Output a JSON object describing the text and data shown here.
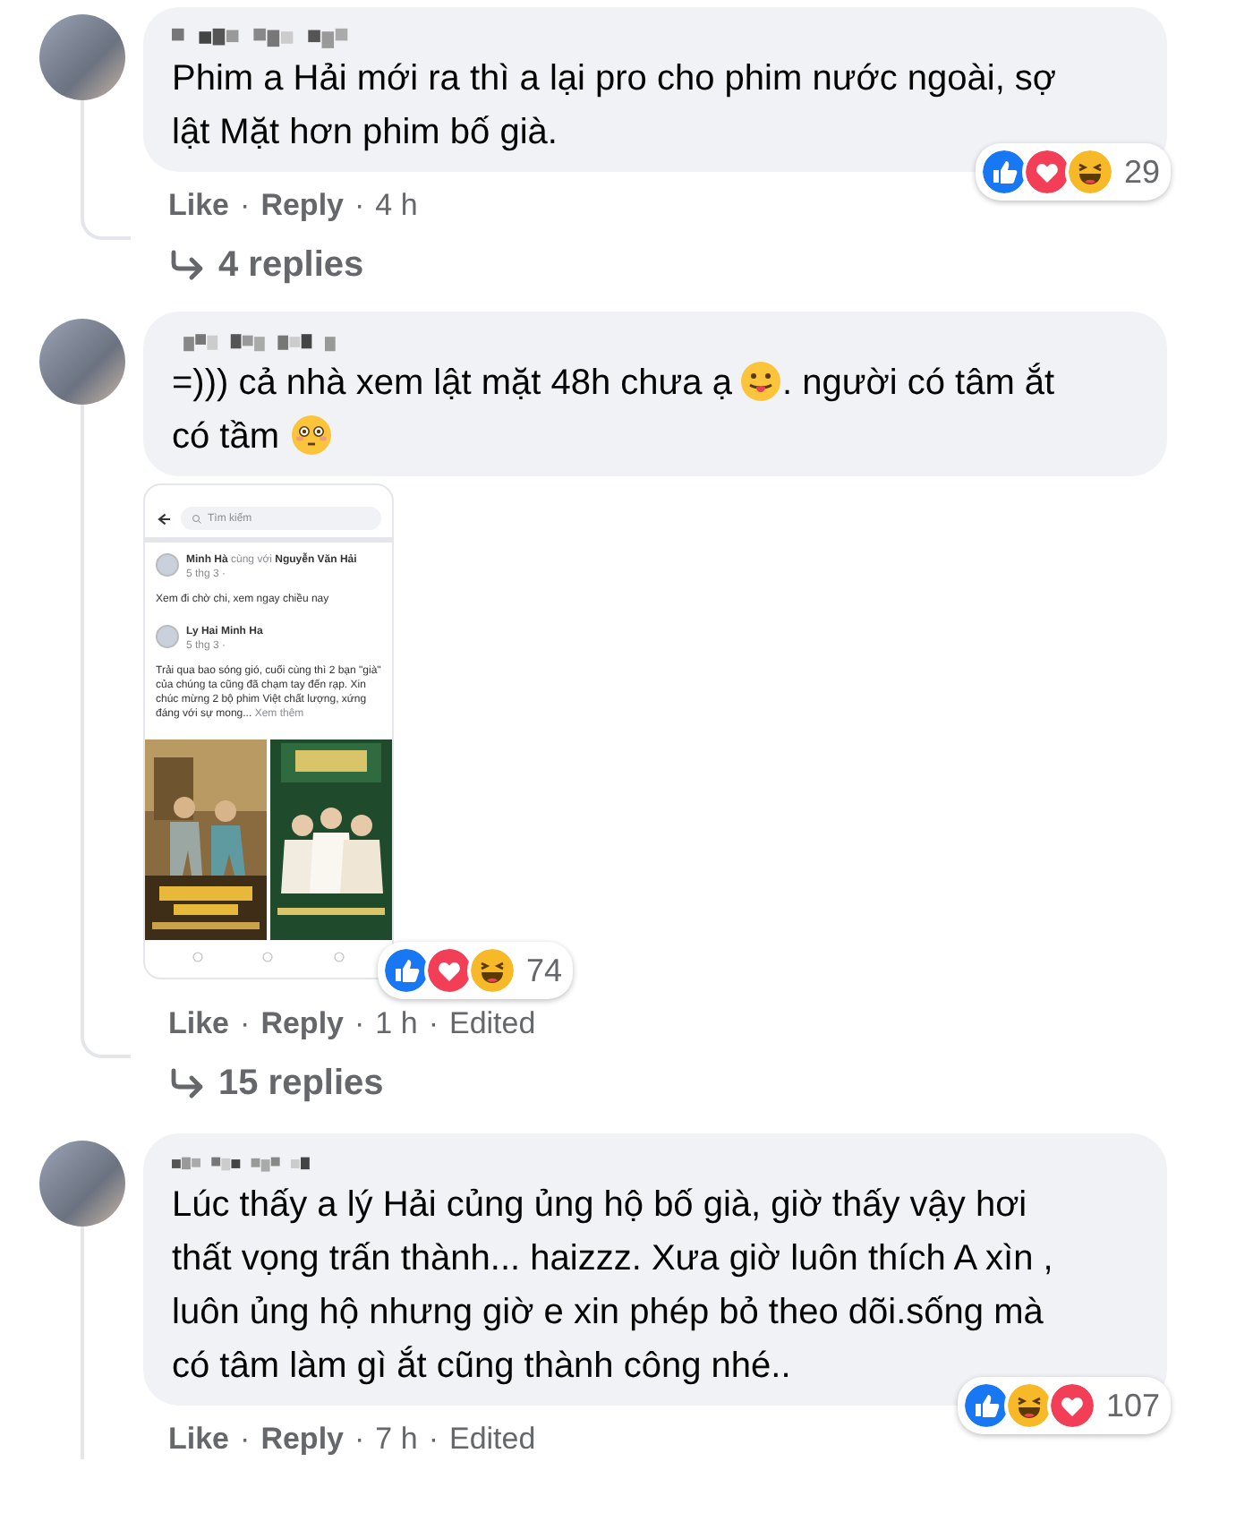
{
  "comments": [
    {
      "text_parts": [
        {
          "kind": "text",
          "text": "Phim a Hải mới ra thì a lại pro cho phim nước ngoài, sợ lật Mặt hơn phim bố già."
        }
      ],
      "reactions": [
        {
          "kind": "like"
        },
        {
          "kind": "love"
        },
        {
          "kind": "haha"
        }
      ],
      "reaction_count": "29",
      "actions": [
        "Like",
        "·",
        "Reply",
        "·",
        "4 h"
      ],
      "replies": "4 replies"
    },
    {
      "text_parts": [
        {
          "kind": "text",
          "text": "=))) cả nhà xem lật mặt 48h chưa ạ "
        },
        {
          "kind": "tongue-emoji"
        },
        {
          "kind": "text",
          "text": ". người có tâm ắt"
        },
        {
          "kind": "text",
          "text": "có tầm"
        },
        {
          "kind": "flushed-emoji"
        }
      ],
      "attachment": {
        "kind": "screenshot",
        "search_placeholder": "Tìm kiếm",
        "post": {
          "author": "Minh Hà",
          "with_text": "cùng với",
          "tagged": "Nguyễn Văn Hải",
          "date": "5 thg 3 ·",
          "text": "Xem đi chờ chi, xem ngay chiều nay"
        },
        "shared": {
          "author": "Ly Hai Minh Ha",
          "date": "5 thg 3 ·",
          "text": "Trải qua bao sóng gió, cuối cùng thì 2 bạn \"già\" của chúng ta cũng đã chạm tay đến rạp. Xin chúc mừng 2 bộ phim Việt chất lượng, xứng đáng với sự mong...",
          "more": "Xem thêm"
        }
      },
      "reactions": [
        {
          "kind": "like"
        },
        {
          "kind": "love"
        },
        {
          "kind": "haha"
        }
      ],
      "reaction_count": "74",
      "actions": [
        "Like",
        "·",
        "Reply",
        "·",
        "1 h",
        "·",
        "Edited"
      ],
      "replies": "15 replies"
    },
    {
      "text_parts": [
        {
          "kind": "text",
          "text": "Lúc thấy a lý Hải củng ủng hộ bố già, giờ thấy vậy hơi thất vọng trấn thành... haizzz. Xưa giờ luôn thích A xìn , luôn ủng hộ nhưng giờ e xin phép bỏ theo dõi.sống mà có tâm làm gì ắt cũng thành công nhé.."
        }
      ],
      "reactions": [
        {
          "kind": "like"
        },
        {
          "kind": "haha"
        },
        {
          "kind": "love"
        }
      ],
      "reaction_count": "107",
      "actions": [
        "Like",
        "·",
        "Reply",
        "·",
        "7 h",
        "·",
        "Edited"
      ]
    }
  ]
}
